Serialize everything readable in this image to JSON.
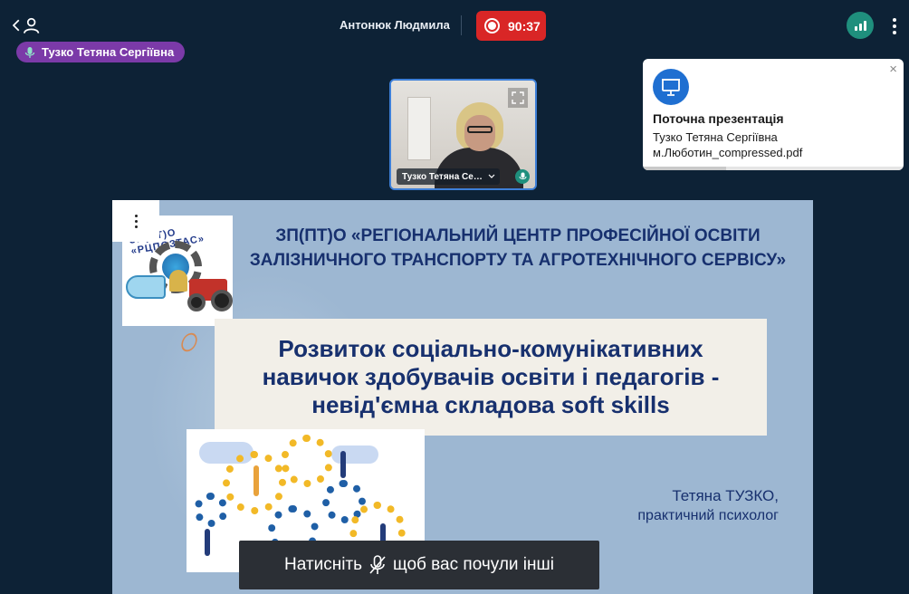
{
  "header": {
    "host_name": "Антонюк Людмила",
    "recording_time": "90:37",
    "active_speaker": "Тузко Тетяна Сергіївна"
  },
  "notification": {
    "title": "Поточна презентація",
    "presenter": "Тузко Тетяна Сергіївна",
    "file": "м.Люботин_compressed.pdf",
    "close_symbol": "×"
  },
  "video": {
    "label": "Тузко Тетяна Се…"
  },
  "slide": {
    "logo_text": "ЗП(ПТ)О «РЦПОЗТАС»",
    "org_line1": "ЗП(ПТ)О «РЕГІОНАЛЬНИЙ ЦЕНТР ПРОФЕСІЙНОЇ ОСВІТИ",
    "org_line2": "ЗАЛІЗНИЧНОГО ТРАНСПОРТУ ТА АГРОТЕХНІЧНОГО СЕРВІСУ»",
    "title_line1": "Розвиток соціально-комунікативних",
    "title_line2": "навичок здобувачів освіти і педагогів -",
    "title_line3": "невід'ємна складова soft skills",
    "author_name": "Тетяна ТУЗКО,",
    "author_role": "практичний психолог"
  },
  "toast": {
    "before": "Натисніть",
    "after": "щоб вас почули інші"
  },
  "colors": {
    "background": "#0d2236",
    "record": "#d92626",
    "speaker_pill": "#7b3aa8",
    "signal": "#1f8f7d",
    "slide_bg": "#9db7d2",
    "slide_text": "#17306e"
  },
  "icons": [
    "back-chevron-icon",
    "user-icon",
    "microphone-icon",
    "record-icon",
    "signal-bars-icon",
    "more-vertical-icon",
    "presentation-icon",
    "close-icon",
    "expand-icon",
    "microphone-off-icon"
  ]
}
